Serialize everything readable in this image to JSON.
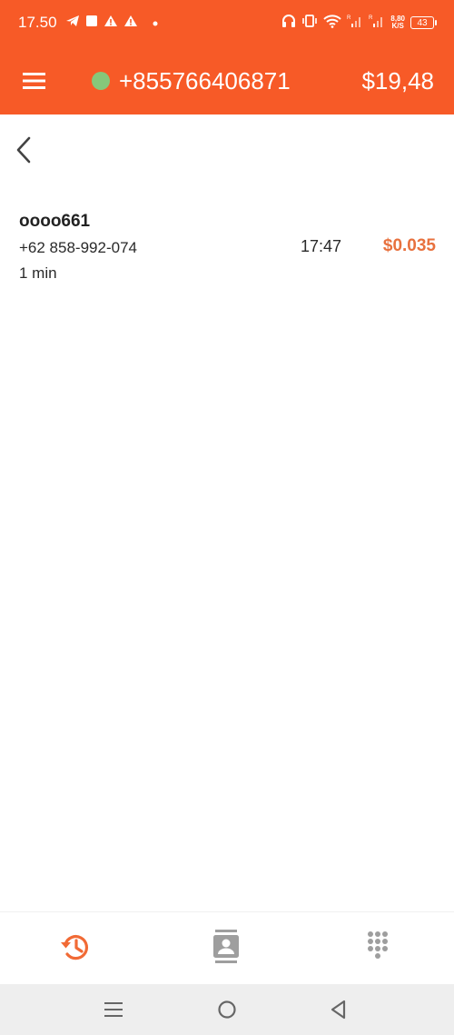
{
  "status_bar": {
    "time": "17.50",
    "network_speed_value": "8,80",
    "network_speed_unit": "K/S",
    "battery_level": "43",
    "left_icons": [
      "telegram-icon",
      "square-notification-icon",
      "warning-icon",
      "warning-icon",
      "dot-icon"
    ],
    "right_icons": [
      "headphones-icon",
      "vibrate-icon",
      "wifi-icon",
      "signal-icon",
      "signal-icon"
    ]
  },
  "app_bar": {
    "account_number": "+855766406871",
    "balance": "$19,48",
    "online_status_color": "#86c77a"
  },
  "call_entry": {
    "name": "oooo661",
    "number": "+62 858-992-074",
    "duration": "1 min",
    "time": "17:47",
    "cost": "$0.035"
  },
  "bottom_nav": {
    "items": [
      {
        "icon": "history-icon",
        "active": true
      },
      {
        "icon": "contacts-icon",
        "active": false
      },
      {
        "icon": "dialpad-icon",
        "active": false
      }
    ]
  },
  "colors": {
    "brand": "#f75a27",
    "cost": "#e8713e",
    "inactive_icon": "#9e9e9e"
  }
}
